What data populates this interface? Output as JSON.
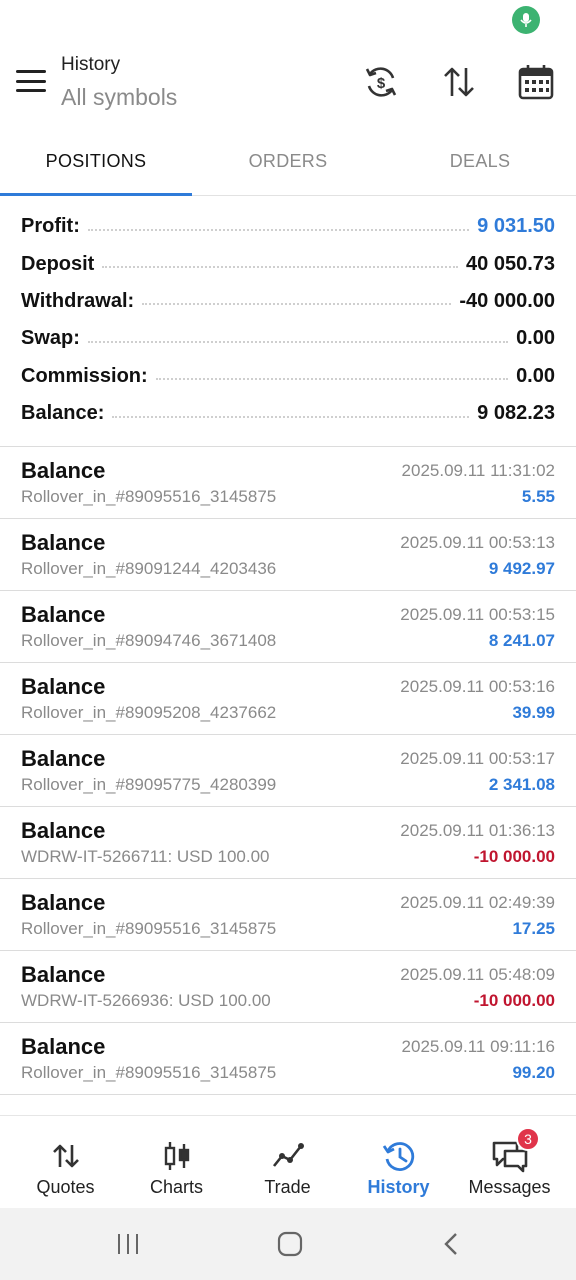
{
  "header": {
    "title": "History",
    "subtitle": "All symbols"
  },
  "tabs": [
    {
      "label": "POSITIONS",
      "active": true
    },
    {
      "label": "ORDERS",
      "active": false
    },
    {
      "label": "DEALS",
      "active": false
    }
  ],
  "summary": {
    "profit": {
      "label": "Profit:",
      "value": "9 031.50"
    },
    "deposit": {
      "label": "Deposit",
      "value": "40 050.73"
    },
    "withdrawal": {
      "label": "Withdrawal:",
      "value": "-40 000.00"
    },
    "swap": {
      "label": "Swap:",
      "value": "0.00"
    },
    "commission": {
      "label": "Commission:",
      "value": "0.00"
    },
    "balance": {
      "label": "Balance:",
      "value": "9 082.23"
    }
  },
  "deals": [
    {
      "type": "Balance",
      "comment": "Rollover_in_#89095516_3145875",
      "time": "2025.09.11 11:31:02",
      "amount": "5.55",
      "negative": false
    },
    {
      "type": "Balance",
      "comment": "Rollover_in_#89091244_4203436",
      "time": "2025.09.11 00:53:13",
      "amount": "9 492.97",
      "negative": false
    },
    {
      "type": "Balance",
      "comment": "Rollover_in_#89094746_3671408",
      "time": "2025.09.11 00:53:15",
      "amount": "8 241.07",
      "negative": false
    },
    {
      "type": "Balance",
      "comment": "Rollover_in_#89095208_4237662",
      "time": "2025.09.11 00:53:16",
      "amount": "39.99",
      "negative": false
    },
    {
      "type": "Balance",
      "comment": "Rollover_in_#89095775_4280399",
      "time": "2025.09.11 00:53:17",
      "amount": "2 341.08",
      "negative": false
    },
    {
      "type": "Balance",
      "comment": "WDRW-IT-5266711: USD 100.00",
      "time": "2025.09.11 01:36:13",
      "amount": "-10 000.00",
      "negative": true
    },
    {
      "type": "Balance",
      "comment": "Rollover_in_#89095516_3145875",
      "time": "2025.09.11 02:49:39",
      "amount": "17.25",
      "negative": false
    },
    {
      "type": "Balance",
      "comment": "WDRW-IT-5266936: USD 100.00",
      "time": "2025.09.11 05:48:09",
      "amount": "-10 000.00",
      "negative": true
    },
    {
      "type": "Balance",
      "comment": "Rollover_in_#89095516_3145875",
      "time": "2025.09.11 09:11:16",
      "amount": "99.20",
      "negative": false
    }
  ],
  "nav": {
    "quotes": "Quotes",
    "charts": "Charts",
    "trade": "Trade",
    "history": "History",
    "messages": "Messages",
    "messages_badge": "3"
  },
  "colors": {
    "accent": "#2f7bd9",
    "negative": "#c0152f",
    "badge": "#e0344a"
  }
}
